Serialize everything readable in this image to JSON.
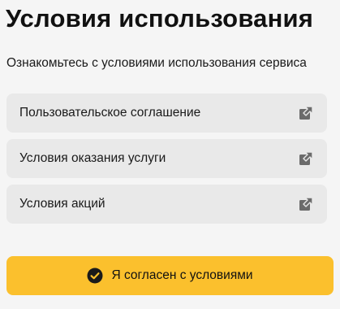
{
  "page": {
    "title": "Условия использования",
    "subtitle": "Ознакомьтесь с условиями использования сервиса"
  },
  "links": [
    {
      "label": "Пользовательское соглашение",
      "icon": "external-link-icon"
    },
    {
      "label": "Условия оказания услуги",
      "icon": "external-link-icon"
    },
    {
      "label": "Условия акций",
      "icon": "external-link-icon"
    }
  ],
  "agree_button": {
    "label": "Я согласен с условиями",
    "icon": "check-circle-icon",
    "color": "#fbc02d"
  },
  "colors": {
    "background": "#f5f5f5",
    "row_background": "#e9e9e9",
    "accent": "#fbc02d"
  }
}
